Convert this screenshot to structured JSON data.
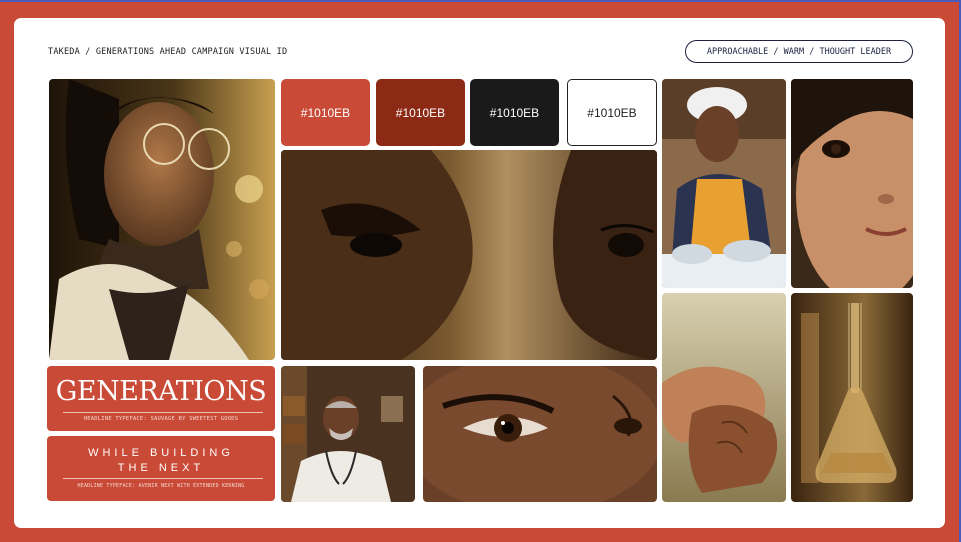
{
  "header": {
    "title": "TAKEDA / GENERATIONS AHEAD CAMPAIGN VISUAL ID",
    "tone_pill": "APPROACHABLE / WARM / THOUGHT LEADER"
  },
  "colors": {
    "frame": "#c94a36",
    "board": "#ffffff",
    "swatch_1": "#c94a36",
    "swatch_2": "#8c2a16",
    "swatch_3": "#1a1a1a",
    "swatch_4": "#ffffff"
  },
  "swatches": [
    {
      "label": "#1010EB"
    },
    {
      "label": "#1010EB"
    },
    {
      "label": "#1010EB"
    },
    {
      "label": "#1010EB"
    }
  ],
  "typography": {
    "headline_word": "GENERATIONS",
    "headline_caption": "HEADLINE TYPEFACE: SAUVAGE BY SWEETEST GOODS",
    "subhead_line1": "WHILE BUILDING",
    "subhead_line2": "THE NEXT",
    "subhead_caption": "HEADLINE TYPEFACE: AVENIR NEXT WITH EXTENDED KERNING"
  },
  "photos": [
    {
      "subject": "scientist-with-glasses"
    },
    {
      "subject": "eye-closeup-profile"
    },
    {
      "subject": "worker-hairnet-apron"
    },
    {
      "subject": "child-face-closeup"
    },
    {
      "subject": "hands-holding"
    },
    {
      "subject": "lab-flask"
    },
    {
      "subject": "elderly-doctor"
    },
    {
      "subject": "eye-closeup"
    }
  ]
}
